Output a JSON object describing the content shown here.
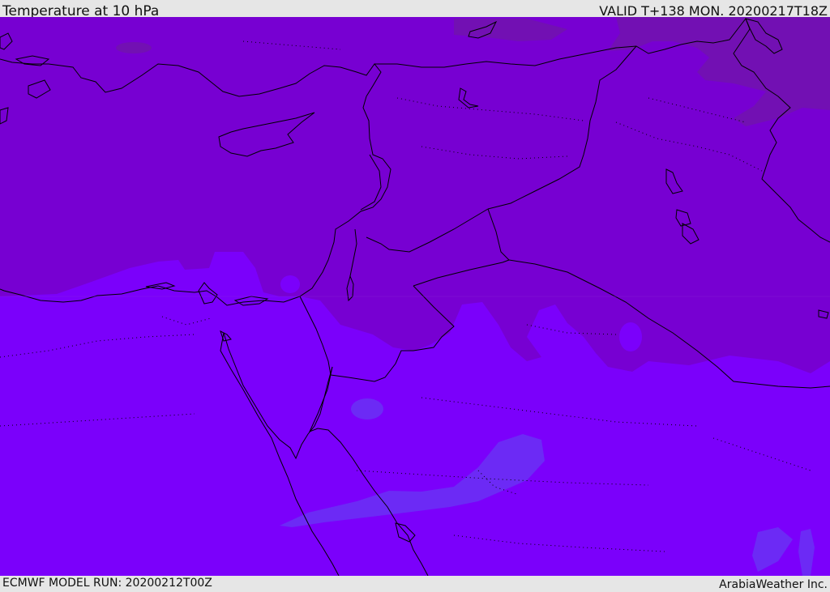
{
  "header": {
    "title": "Temperature at 10 hPa",
    "valid": "VALID T+138 MON. 20200217T18Z"
  },
  "footer": {
    "model_run": "ECMWF MODEL RUN: 20200212T00Z",
    "credit": "ArabiaWeather Inc."
  },
  "colors": {
    "field_north": "#7700d2",
    "field_south": "#7b00fb",
    "warm_patch_ne": "#7210b3",
    "cool_patch": "#6c2af5",
    "coastline": "#000000"
  }
}
